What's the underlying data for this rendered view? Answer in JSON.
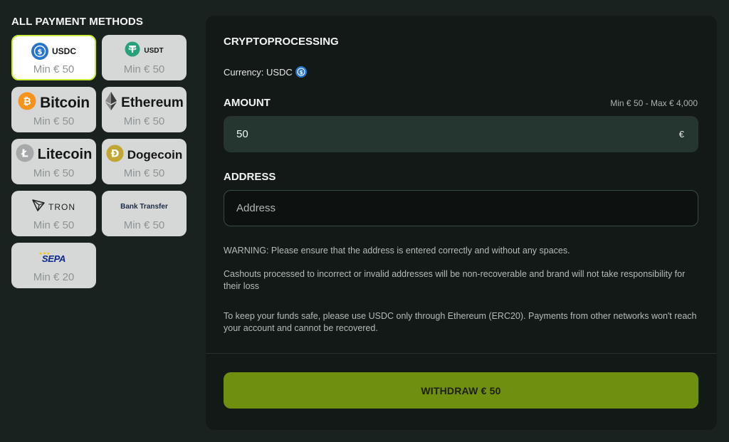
{
  "sidebar": {
    "title": "ALL PAYMENT METHODS",
    "methods": [
      {
        "name": "USDC",
        "min": "Min € 50",
        "selected": true,
        "icon": "usdc-icon",
        "color": "#2775ca"
      },
      {
        "name": "USDT",
        "min": "Min € 50",
        "selected": false,
        "icon": "tether-icon",
        "color": "#26a17b"
      },
      {
        "name": "Bitcoin",
        "min": "Min € 50",
        "selected": false,
        "icon": "bitcoin-icon",
        "color": "#f7931a"
      },
      {
        "name": "Ethereum",
        "min": "Min € 50",
        "selected": false,
        "icon": "ethereum-icon",
        "color": "#3c3c3d"
      },
      {
        "name": "Litecoin",
        "min": "Min € 50",
        "selected": false,
        "icon": "litecoin-icon",
        "color": "#a6a9aa"
      },
      {
        "name": "Dogecoin",
        "min": "Min € 50",
        "selected": false,
        "icon": "dogecoin-icon",
        "color": "#c2a633"
      },
      {
        "name": "TRON",
        "min": "Min € 50",
        "selected": false,
        "icon": "tron-icon",
        "color": "#2b2b2b"
      },
      {
        "name": "Bank Transfer",
        "min": "Min € 50",
        "selected": false,
        "icon": "bank-transfer-logo",
        "color": "#1d2b45"
      },
      {
        "name": "SEPA",
        "min": "Min € 20",
        "selected": false,
        "icon": "sepa-logo",
        "color": "#10298e"
      }
    ]
  },
  "panel": {
    "title": "CRYPTOPROCESSING",
    "currency_label": "Currency: USDC",
    "amount": {
      "label": "AMOUNT",
      "range": "Min € 50 - Max € 4,000",
      "value": "50",
      "currency_symbol": "€"
    },
    "address": {
      "label": "ADDRESS",
      "placeholder": "Address",
      "value": ""
    },
    "warning": "WARNING: Please ensure that the address is entered correctly and without any spaces.",
    "cashout_note": "Cashouts processed to incorrect or invalid addresses will be non-recoverable and brand will not take responsibility for their loss",
    "network_note": "To keep your funds safe, please use USDC only through Ethereum (ERC20). Payments from other networks won't reach your account and cannot be recovered.",
    "withdraw_button": "WITHDRAW € 50"
  },
  "colors": {
    "accent": "#6f8f0f",
    "selected_border": "#c8ec3a",
    "background": "#1a221f",
    "panel": "#121917"
  }
}
